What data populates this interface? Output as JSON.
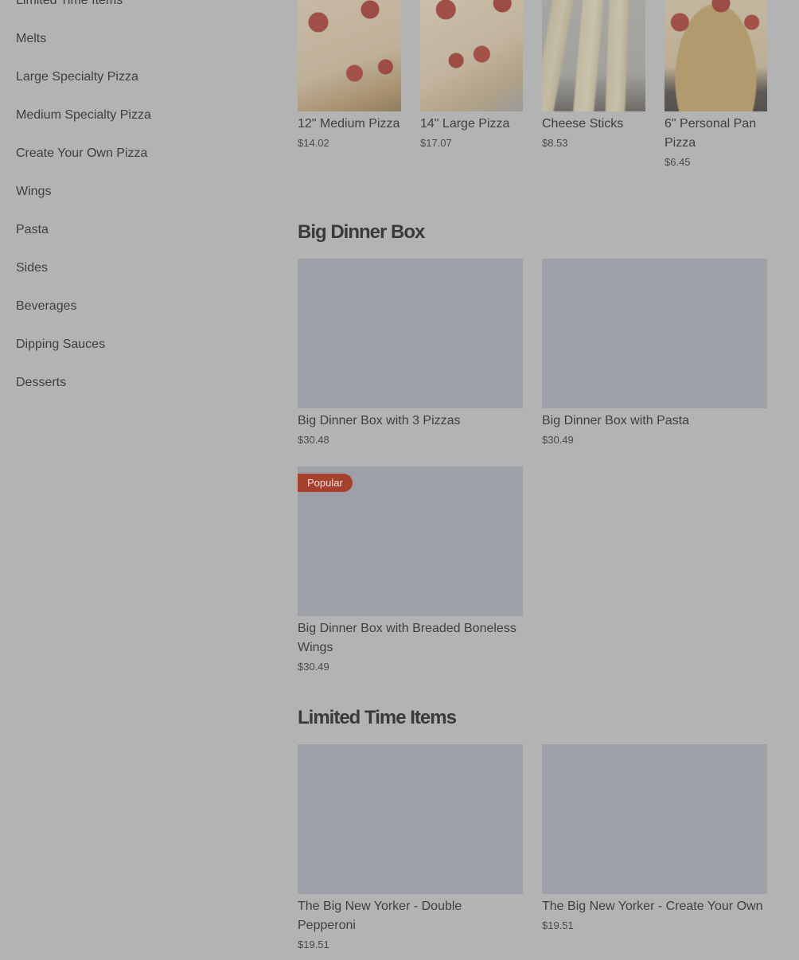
{
  "sidebar": {
    "items": [
      {
        "label": "Limited Time Items"
      },
      {
        "label": "Melts"
      },
      {
        "label": "Large Specialty Pizza"
      },
      {
        "label": "Medium Specialty Pizza"
      },
      {
        "label": "Create Your Own Pizza"
      },
      {
        "label": "Wings"
      },
      {
        "label": "Pasta"
      },
      {
        "label": "Sides"
      },
      {
        "label": "Beverages"
      },
      {
        "label": "Dipping Sauces"
      },
      {
        "label": "Desserts"
      }
    ]
  },
  "top_row": {
    "items": [
      {
        "name": "12\" Medium Pizza",
        "price": "$14.02",
        "image": "pizza"
      },
      {
        "name": "14\" Large Pizza",
        "price": "$17.07",
        "image": "pizza"
      },
      {
        "name": "Cheese Sticks",
        "price": "$8.53",
        "image": "cheese-sticks"
      },
      {
        "name": "6\" Personal Pan Pizza",
        "price": "$6.45",
        "image": "pizza"
      }
    ]
  },
  "big_dinner_box": {
    "title": "Big Dinner Box",
    "items": [
      {
        "name": "Big Dinner Box with 3 Pizzas",
        "price": "$30.48"
      },
      {
        "name": "Big Dinner Box with Pasta",
        "price": "$30.49"
      },
      {
        "name": "Big Dinner Box with Breaded Boneless Wings",
        "price": "$30.49",
        "badge": "Popular"
      }
    ]
  },
  "limited_time": {
    "title": "Limited Time Items",
    "items": [
      {
        "name": "The Big New Yorker - Double Pepperoni",
        "price": "$19.51"
      },
      {
        "name": "The Big New Yorker - Create Your Own",
        "price": "$19.51"
      }
    ]
  },
  "colors": {
    "overlay_background": "#b3b3b3",
    "image_placeholder": "#9da0a6",
    "badge_background": "#a6402e",
    "text": "#3f3f3f"
  }
}
